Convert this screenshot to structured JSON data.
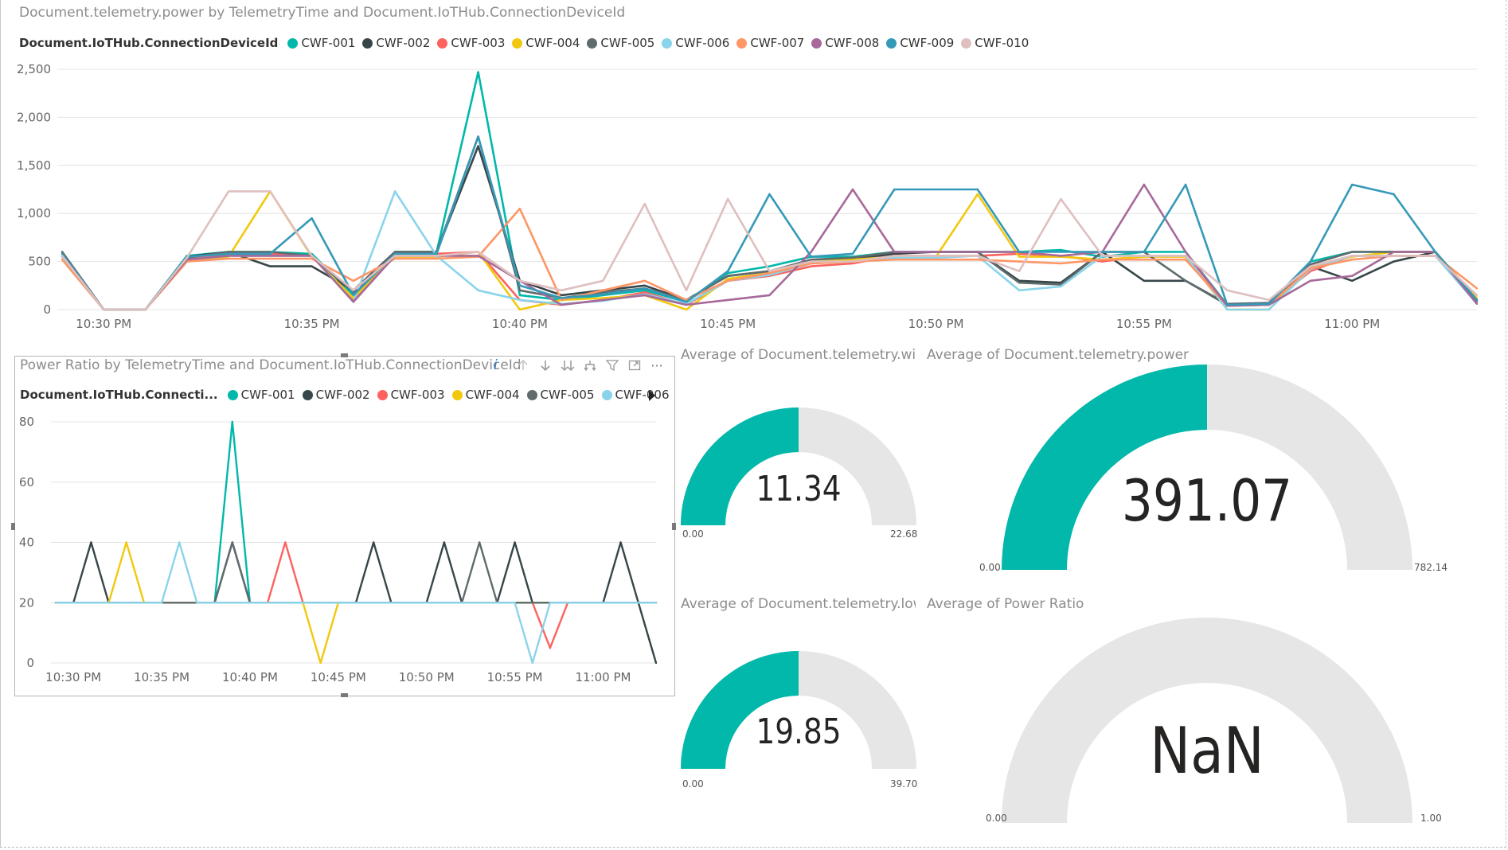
{
  "colors": {
    "CWF-001": "#01B8AA",
    "CWF-002": "#374649",
    "CWF-003": "#FD625E",
    "CWF-004": "#F2C80F",
    "CWF-005": "#5F6B6D",
    "CWF-006": "#8AD4EB",
    "CWF-007": "#FE9666",
    "CWF-008": "#A66999",
    "CWF-009": "#3599B8",
    "CWF-010": "#DFBFBF",
    "gauge_fill": "#01B8AA",
    "gauge_track": "#E6E6E6"
  },
  "top_chart": {
    "title": "Document.telemetry.power by TelemetryTime and Document.IoTHub.ConnectionDeviceId",
    "legend_title": "Document.IoTHub.ConnectionDeviceId",
    "legend": [
      "CWF-001",
      "CWF-002",
      "CWF-003",
      "CWF-004",
      "CWF-005",
      "CWF-006",
      "CWF-007",
      "CWF-008",
      "CWF-009",
      "CWF-010"
    ],
    "y_ticks": [
      "0",
      "500",
      "1,000",
      "1,500",
      "2,000",
      "2,500"
    ],
    "x_ticks": [
      "10:30 PM",
      "10:35 PM",
      "10:40 PM",
      "10:45 PM",
      "10:50 PM",
      "10:55 PM",
      "11:00 PM"
    ]
  },
  "bottom_chart": {
    "title": "Power Ratio by TelemetryTime and Document.IoTHub.ConnectionDeviceId",
    "legend_title": "Document.IoTHub.Connecti...",
    "legend": [
      "CWF-001",
      "CWF-002",
      "CWF-003",
      "CWF-004",
      "CWF-005",
      "CWF-006"
    ],
    "y_ticks": [
      "0",
      "20",
      "40",
      "60",
      "80"
    ],
    "x_ticks": [
      "10:30 PM",
      "10:35 PM",
      "10:40 PM",
      "10:45 PM",
      "10:50 PM",
      "10:55 PM",
      "11:00 PM"
    ],
    "info_glyph": "i"
  },
  "toolbar": {
    "icons": [
      "drill-up-icon",
      "drill-down-icon",
      "expand-all-icon",
      "expand-hierarchy-icon",
      "filter-icon",
      "focus-mode-icon",
      "more-options-icon"
    ],
    "more_label": "···"
  },
  "gauges": [
    {
      "title": "Average of Document.telemetry.win...",
      "value": "11.34",
      "min": "0.00",
      "max": "22.68",
      "fraction": 0.5
    },
    {
      "title": "Average of Document.telemetry.power",
      "value": "391.07",
      "min": "0.00",
      "max": "782.14",
      "fraction": 0.5
    },
    {
      "title": "Average of Document.telemetry.low...",
      "value": "19.85",
      "min": "0.00",
      "max": "39.70",
      "fraction": 0.5
    },
    {
      "title": "Average of Power Ratio",
      "value": "NaN",
      "min": "0.00",
      "max": "1.00",
      "fraction": 0
    }
  ],
  "chart_data": [
    {
      "type": "line",
      "title": "Document.telemetry.power by TelemetryTime and Document.IoTHub.ConnectionDeviceId",
      "xlabel": "",
      "ylabel": "",
      "ylim": [
        0,
        2500
      ],
      "x": [
        "10:29",
        "10:30",
        "10:31",
        "10:32",
        "10:33",
        "10:34",
        "10:35",
        "10:36",
        "10:37",
        "10:38",
        "10:39",
        "10:40",
        "10:41",
        "10:42",
        "10:43",
        "10:44",
        "10:45",
        "10:46",
        "10:47",
        "10:48",
        "10:49",
        "10:50",
        "10:51",
        "10:52",
        "10:53",
        "10:54",
        "10:55",
        "10:56",
        "10:57",
        "10:58",
        "10:59",
        "11:00",
        "11:01",
        "11:02",
        "11:03"
      ],
      "series": [
        {
          "name": "CWF-001",
          "values": [
            550,
            0,
            0,
            560,
            600,
            600,
            580,
            150,
            600,
            600,
            2470,
            150,
            100,
            150,
            200,
            80,
            380,
            450,
            550,
            550,
            600,
            600,
            600,
            600,
            620,
            550,
            600,
            600,
            50,
            60,
            500,
            600,
            600,
            600,
            100
          ]
        },
        {
          "name": "CWF-002",
          "values": [
            600,
            0,
            0,
            550,
            600,
            450,
            450,
            200,
            600,
            600,
            1700,
            300,
            150,
            200,
            250,
            100,
            350,
            400,
            500,
            520,
            580,
            600,
            600,
            300,
            280,
            600,
            300,
            300,
            50,
            60,
            450,
            300,
            500,
            600,
            100
          ]
        },
        {
          "name": "CWF-003",
          "values": [
            580,
            0,
            0,
            530,
            580,
            580,
            560,
            100,
            580,
            580,
            600,
            100,
            50,
            100,
            180,
            50,
            300,
            350,
            450,
            480,
            560,
            560,
            560,
            580,
            560,
            500,
            560,
            560,
            40,
            50,
            400,
            560,
            560,
            560,
            80
          ]
        },
        {
          "name": "CWF-004",
          "values": [
            550,
            0,
            0,
            500,
            550,
            1230,
            550,
            120,
            550,
            550,
            600,
            0,
            100,
            120,
            150,
            0,
            320,
            380,
            500,
            520,
            550,
            550,
            1200,
            550,
            550,
            520,
            550,
            550,
            0,
            0,
            450,
            550,
            600,
            600,
            120
          ]
        },
        {
          "name": "CWF-005",
          "values": [
            600,
            0,
            0,
            540,
            600,
            600,
            560,
            180,
            600,
            600,
            1800,
            200,
            120,
            180,
            220,
            100,
            350,
            400,
            520,
            540,
            600,
            600,
            600,
            280,
            260,
            600,
            600,
            300,
            60,
            70,
            470,
            600,
            600,
            600,
            90
          ]
        },
        {
          "name": "CWF-006",
          "values": [
            550,
            0,
            0,
            520,
            560,
            560,
            560,
            80,
            1230,
            560,
            200,
            100,
            60,
            90,
            160,
            60,
            300,
            360,
            480,
            500,
            540,
            540,
            560,
            200,
            240,
            560,
            560,
            560,
            0,
            0,
            420,
            560,
            560,
            560,
            60
          ]
        },
        {
          "name": "CWF-007",
          "values": [
            520,
            0,
            0,
            500,
            530,
            530,
            530,
            300,
            530,
            530,
            550,
            1050,
            100,
            200,
            300,
            100,
            300,
            380,
            480,
            500,
            520,
            520,
            520,
            500,
            480,
            520,
            520,
            520,
            40,
            50,
            430,
            520,
            560,
            560,
            220
          ]
        },
        {
          "name": "CWF-008",
          "values": [
            560,
            0,
            0,
            520,
            560,
            560,
            560,
            80,
            560,
            560,
            560,
            300,
            50,
            100,
            150,
            50,
            100,
            150,
            600,
            1250,
            600,
            600,
            600,
            600,
            560,
            600,
            1300,
            600,
            40,
            50,
            300,
            350,
            600,
            600,
            60
          ]
        },
        {
          "name": "CWF-009",
          "values": [
            580,
            0,
            0,
            550,
            580,
            580,
            950,
            150,
            580,
            580,
            1800,
            250,
            120,
            160,
            220,
            80,
            400,
            1200,
            550,
            580,
            1250,
            1250,
            1250,
            600,
            600,
            600,
            600,
            1300,
            50,
            60,
            500,
            1300,
            1200,
            600,
            100
          ]
        },
        {
          "name": "CWF-010",
          "values": [
            560,
            0,
            0,
            540,
            1230,
            1230,
            560,
            200,
            560,
            560,
            600,
            300,
            200,
            300,
            1100,
            200,
            1150,
            400,
            500,
            500,
            560,
            560,
            560,
            400,
            1150,
            560,
            560,
            560,
            200,
            100,
            450,
            560,
            560,
            560,
            150
          ]
        }
      ]
    },
    {
      "type": "line",
      "title": "Power Ratio by TelemetryTime and Document.IoTHub.ConnectionDeviceId",
      "xlabel": "",
      "ylabel": "",
      "ylim": [
        0,
        80
      ],
      "x": [
        "10:29",
        "10:30",
        "10:31",
        "10:32",
        "10:33",
        "10:34",
        "10:35",
        "10:36",
        "10:37",
        "10:38",
        "10:39",
        "10:40",
        "10:41",
        "10:42",
        "10:43",
        "10:44",
        "10:45",
        "10:46",
        "10:47",
        "10:48",
        "10:49",
        "10:50",
        "10:51",
        "10:52",
        "10:53",
        "10:54",
        "10:55",
        "10:56",
        "10:57",
        "10:58",
        "10:59",
        "11:00",
        "11:01",
        "11:02",
        "11:03"
      ],
      "series": [
        {
          "name": "CWF-001",
          "values": [
            20,
            20,
            20,
            20,
            20,
            20,
            20,
            20,
            20,
            20,
            80,
            20,
            20,
            20,
            20,
            20,
            20,
            20,
            20,
            20,
            20,
            20,
            20,
            20,
            20,
            20,
            20,
            20,
            20,
            20,
            20,
            20,
            20,
            20,
            20
          ]
        },
        {
          "name": "CWF-002",
          "values": [
            20,
            20,
            40,
            20,
            20,
            20,
            20,
            20,
            20,
            20,
            40,
            20,
            20,
            20,
            20,
            20,
            20,
            20,
            40,
            20,
            20,
            20,
            40,
            20,
            20,
            20,
            40,
            20,
            20,
            20,
            20,
            20,
            40,
            20,
            0
          ]
        },
        {
          "name": "CWF-003",
          "values": [
            20,
            20,
            20,
            20,
            20,
            20,
            20,
            20,
            20,
            20,
            20,
            20,
            20,
            40,
            20,
            20,
            20,
            20,
            20,
            20,
            20,
            20,
            20,
            20,
            20,
            20,
            20,
            20,
            5,
            20,
            20,
            20,
            20,
            20,
            20
          ]
        },
        {
          "name": "CWF-004",
          "values": [
            20,
            20,
            20,
            20,
            40,
            20,
            20,
            20,
            20,
            20,
            20,
            20,
            20,
            20,
            20,
            0,
            20,
            20,
            20,
            20,
            20,
            20,
            20,
            20,
            20,
            20,
            20,
            20,
            20,
            20,
            20,
            20,
            20,
            20,
            20
          ]
        },
        {
          "name": "CWF-005",
          "values": [
            20,
            20,
            20,
            20,
            20,
            20,
            20,
            20,
            20,
            20,
            40,
            20,
            20,
            20,
            20,
            20,
            20,
            20,
            20,
            20,
            20,
            20,
            20,
            20,
            40,
            20,
            20,
            20,
            20,
            20,
            20,
            20,
            20,
            20,
            20
          ]
        },
        {
          "name": "CWF-006",
          "values": [
            20,
            20,
            20,
            20,
            20,
            20,
            20,
            40,
            20,
            20,
            20,
            20,
            20,
            20,
            20,
            20,
            20,
            20,
            20,
            20,
            20,
            20,
            20,
            20,
            20,
            20,
            20,
            0,
            20,
            20,
            20,
            20,
            20,
            20,
            20
          ]
        }
      ]
    }
  ]
}
